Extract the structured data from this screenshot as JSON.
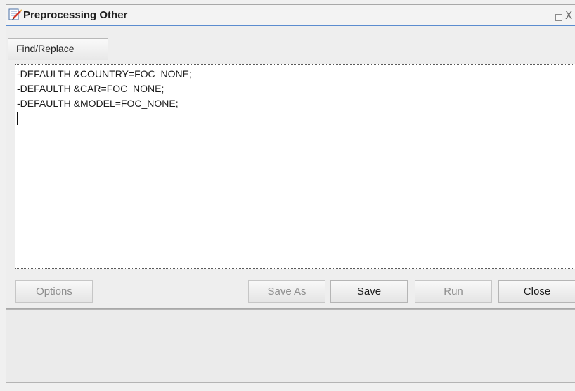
{
  "dialog": {
    "title": "Preprocessing Other",
    "close_glyph": "X",
    "title_icon": "edit-document-icon"
  },
  "toolbar": {
    "find_replace_label": "Find/Replace"
  },
  "editor": {
    "lines": [
      "-DEFAULTH &COUNTRY=FOC_NONE;",
      "-DEFAULTH &CAR=FOC_NONE;",
      "-DEFAULTH &MODEL=FOC_NONE;"
    ]
  },
  "buttons": {
    "options": "Options",
    "save_as": "Save As",
    "save": "Save",
    "run": "Run",
    "close": "Close"
  },
  "colors": {
    "title_underline": "#5b8ccf",
    "disabled_text": "#8e8e8e"
  }
}
